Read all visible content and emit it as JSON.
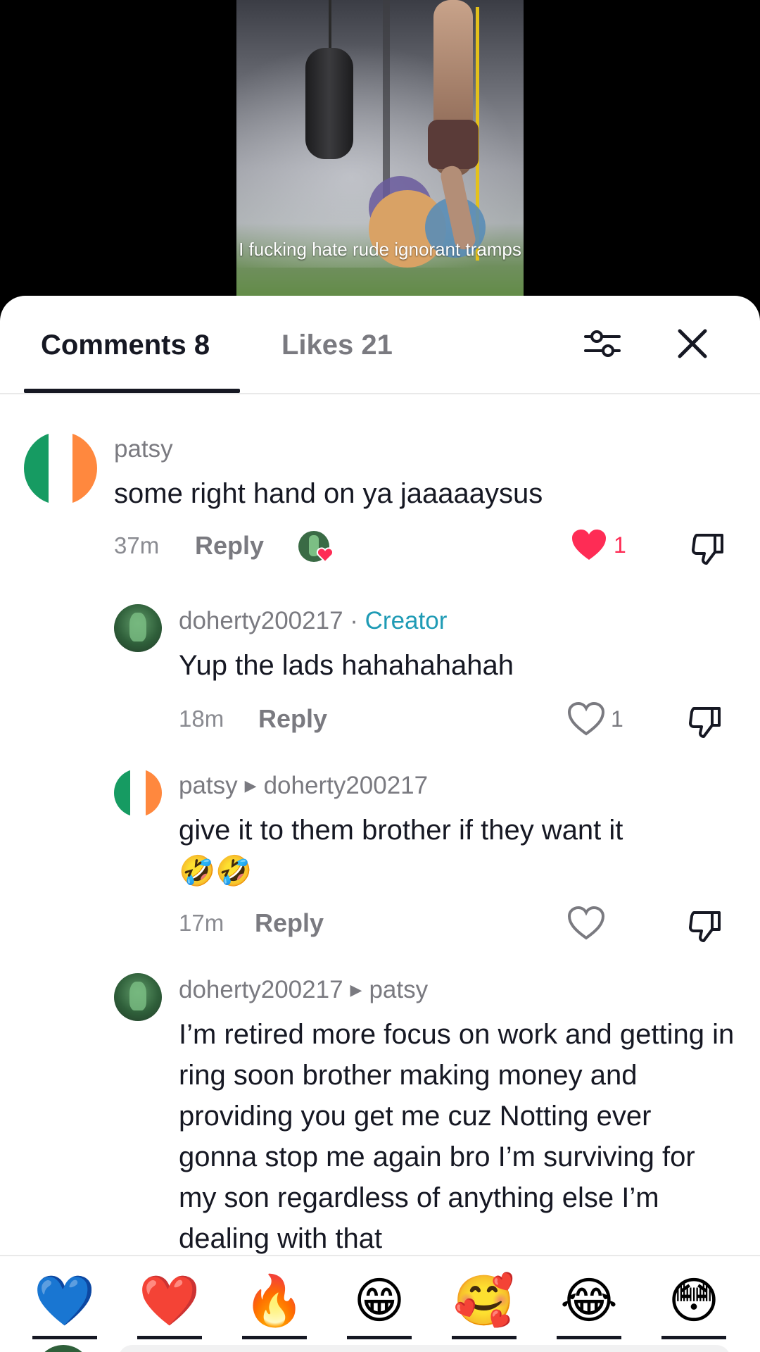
{
  "video": {
    "caption": "I fucking hate rude ignorant tramps"
  },
  "tabs": {
    "comments_label": "Comments 8",
    "likes_label": "Likes 21"
  },
  "icons": {
    "filter": "sliders-icon",
    "close": "close-icon",
    "heart": "heart-icon",
    "dislike": "thumbs-down-icon"
  },
  "colors": {
    "liked": "#fe2c55",
    "creator": "#1f9bb5",
    "text": "#161823",
    "muted": "#7a7a80"
  },
  "comments": [
    {
      "username": "patsy",
      "text": "some right hand on ya jaaaaaysus",
      "time": "37m",
      "reply_label": "Reply",
      "like_count": "1",
      "liked": true,
      "liked_by_creator": true
    },
    {
      "username": "doherty200217",
      "badge_sep": " · ",
      "badge": "Creator",
      "text": "Yup the lads hahahahahah",
      "time": "18m",
      "reply_label": "Reply",
      "like_count": "1",
      "liked": false
    },
    {
      "username": "patsy",
      "reply_to": "doherty200217",
      "text": "give it to them brother if they want it",
      "emojis": "🤣🤣",
      "time": "17m",
      "reply_label": "Reply",
      "like_count": "",
      "liked": false
    },
    {
      "username": "doherty200217",
      "reply_to": "patsy",
      "text": "I’m retired more focus on work and getting in ring soon brother making money and providing you get me cuz Notting ever gonna stop me again bro I’m surviving for my son regardless of anything else I’m dealing with that"
    }
  ],
  "emoji_bar": [
    "💙",
    "❤️",
    "🔥",
    "😁",
    "🥰",
    "😂",
    "😳"
  ]
}
